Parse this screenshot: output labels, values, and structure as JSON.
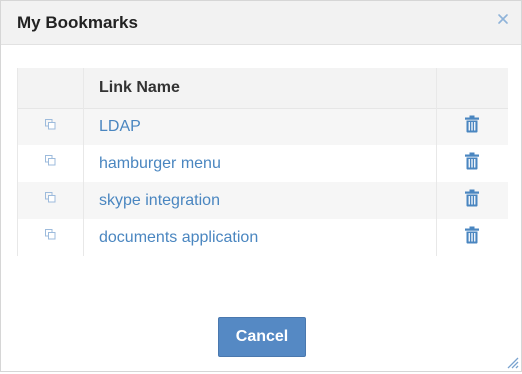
{
  "dialog": {
    "title": "My Bookmarks",
    "close_icon": "close-icon"
  },
  "table": {
    "columns": [
      "",
      "Link Name",
      ""
    ],
    "rows": [
      {
        "name": "LDAP",
        "copy_icon": "copy-icon",
        "delete_icon": "trash-icon"
      },
      {
        "name": "hamburger menu",
        "copy_icon": "copy-icon",
        "delete_icon": "trash-icon"
      },
      {
        "name": "skype integration",
        "copy_icon": "copy-icon",
        "delete_icon": "trash-icon"
      },
      {
        "name": "documents application",
        "copy_icon": "copy-icon",
        "delete_icon": "trash-icon"
      }
    ]
  },
  "footer": {
    "cancel_label": "Cancel"
  },
  "colors": {
    "header_bg": "#f2f2f2",
    "link": "#4a86c0",
    "icon": "#4a86c0",
    "button_bg": "#5589c4"
  }
}
